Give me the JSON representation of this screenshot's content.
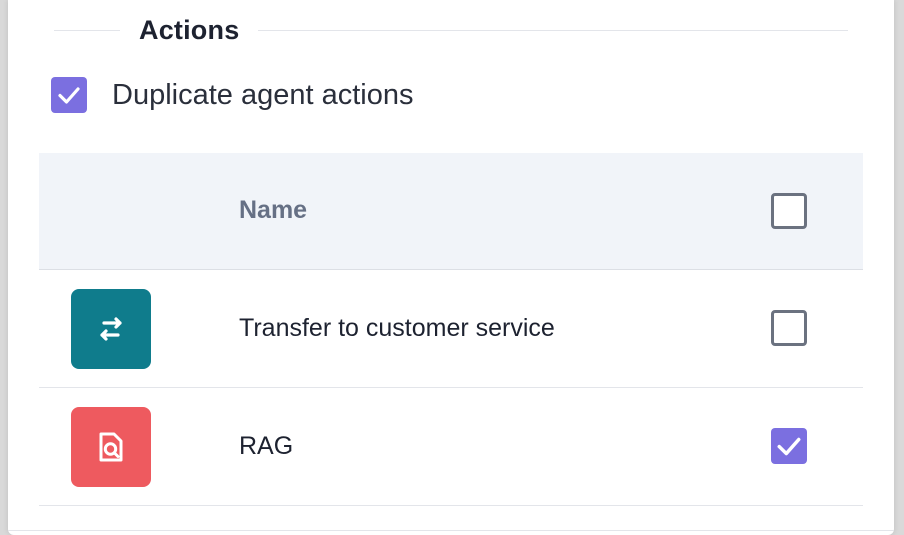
{
  "section": {
    "title": "Actions"
  },
  "duplicate": {
    "label": "Duplicate agent actions",
    "checked": true
  },
  "table": {
    "header_name": "Name",
    "rows": [
      {
        "name": "Transfer to customer service",
        "icon": "transfer-arrows-icon",
        "icon_color": "#0f7c8c",
        "checked": false
      },
      {
        "name": "RAG",
        "icon": "document-search-icon",
        "icon_color": "#ee5a5f",
        "checked": true
      }
    ]
  },
  "colors": {
    "accent": "#7b6fe0",
    "header_bg": "#f1f4f9"
  }
}
